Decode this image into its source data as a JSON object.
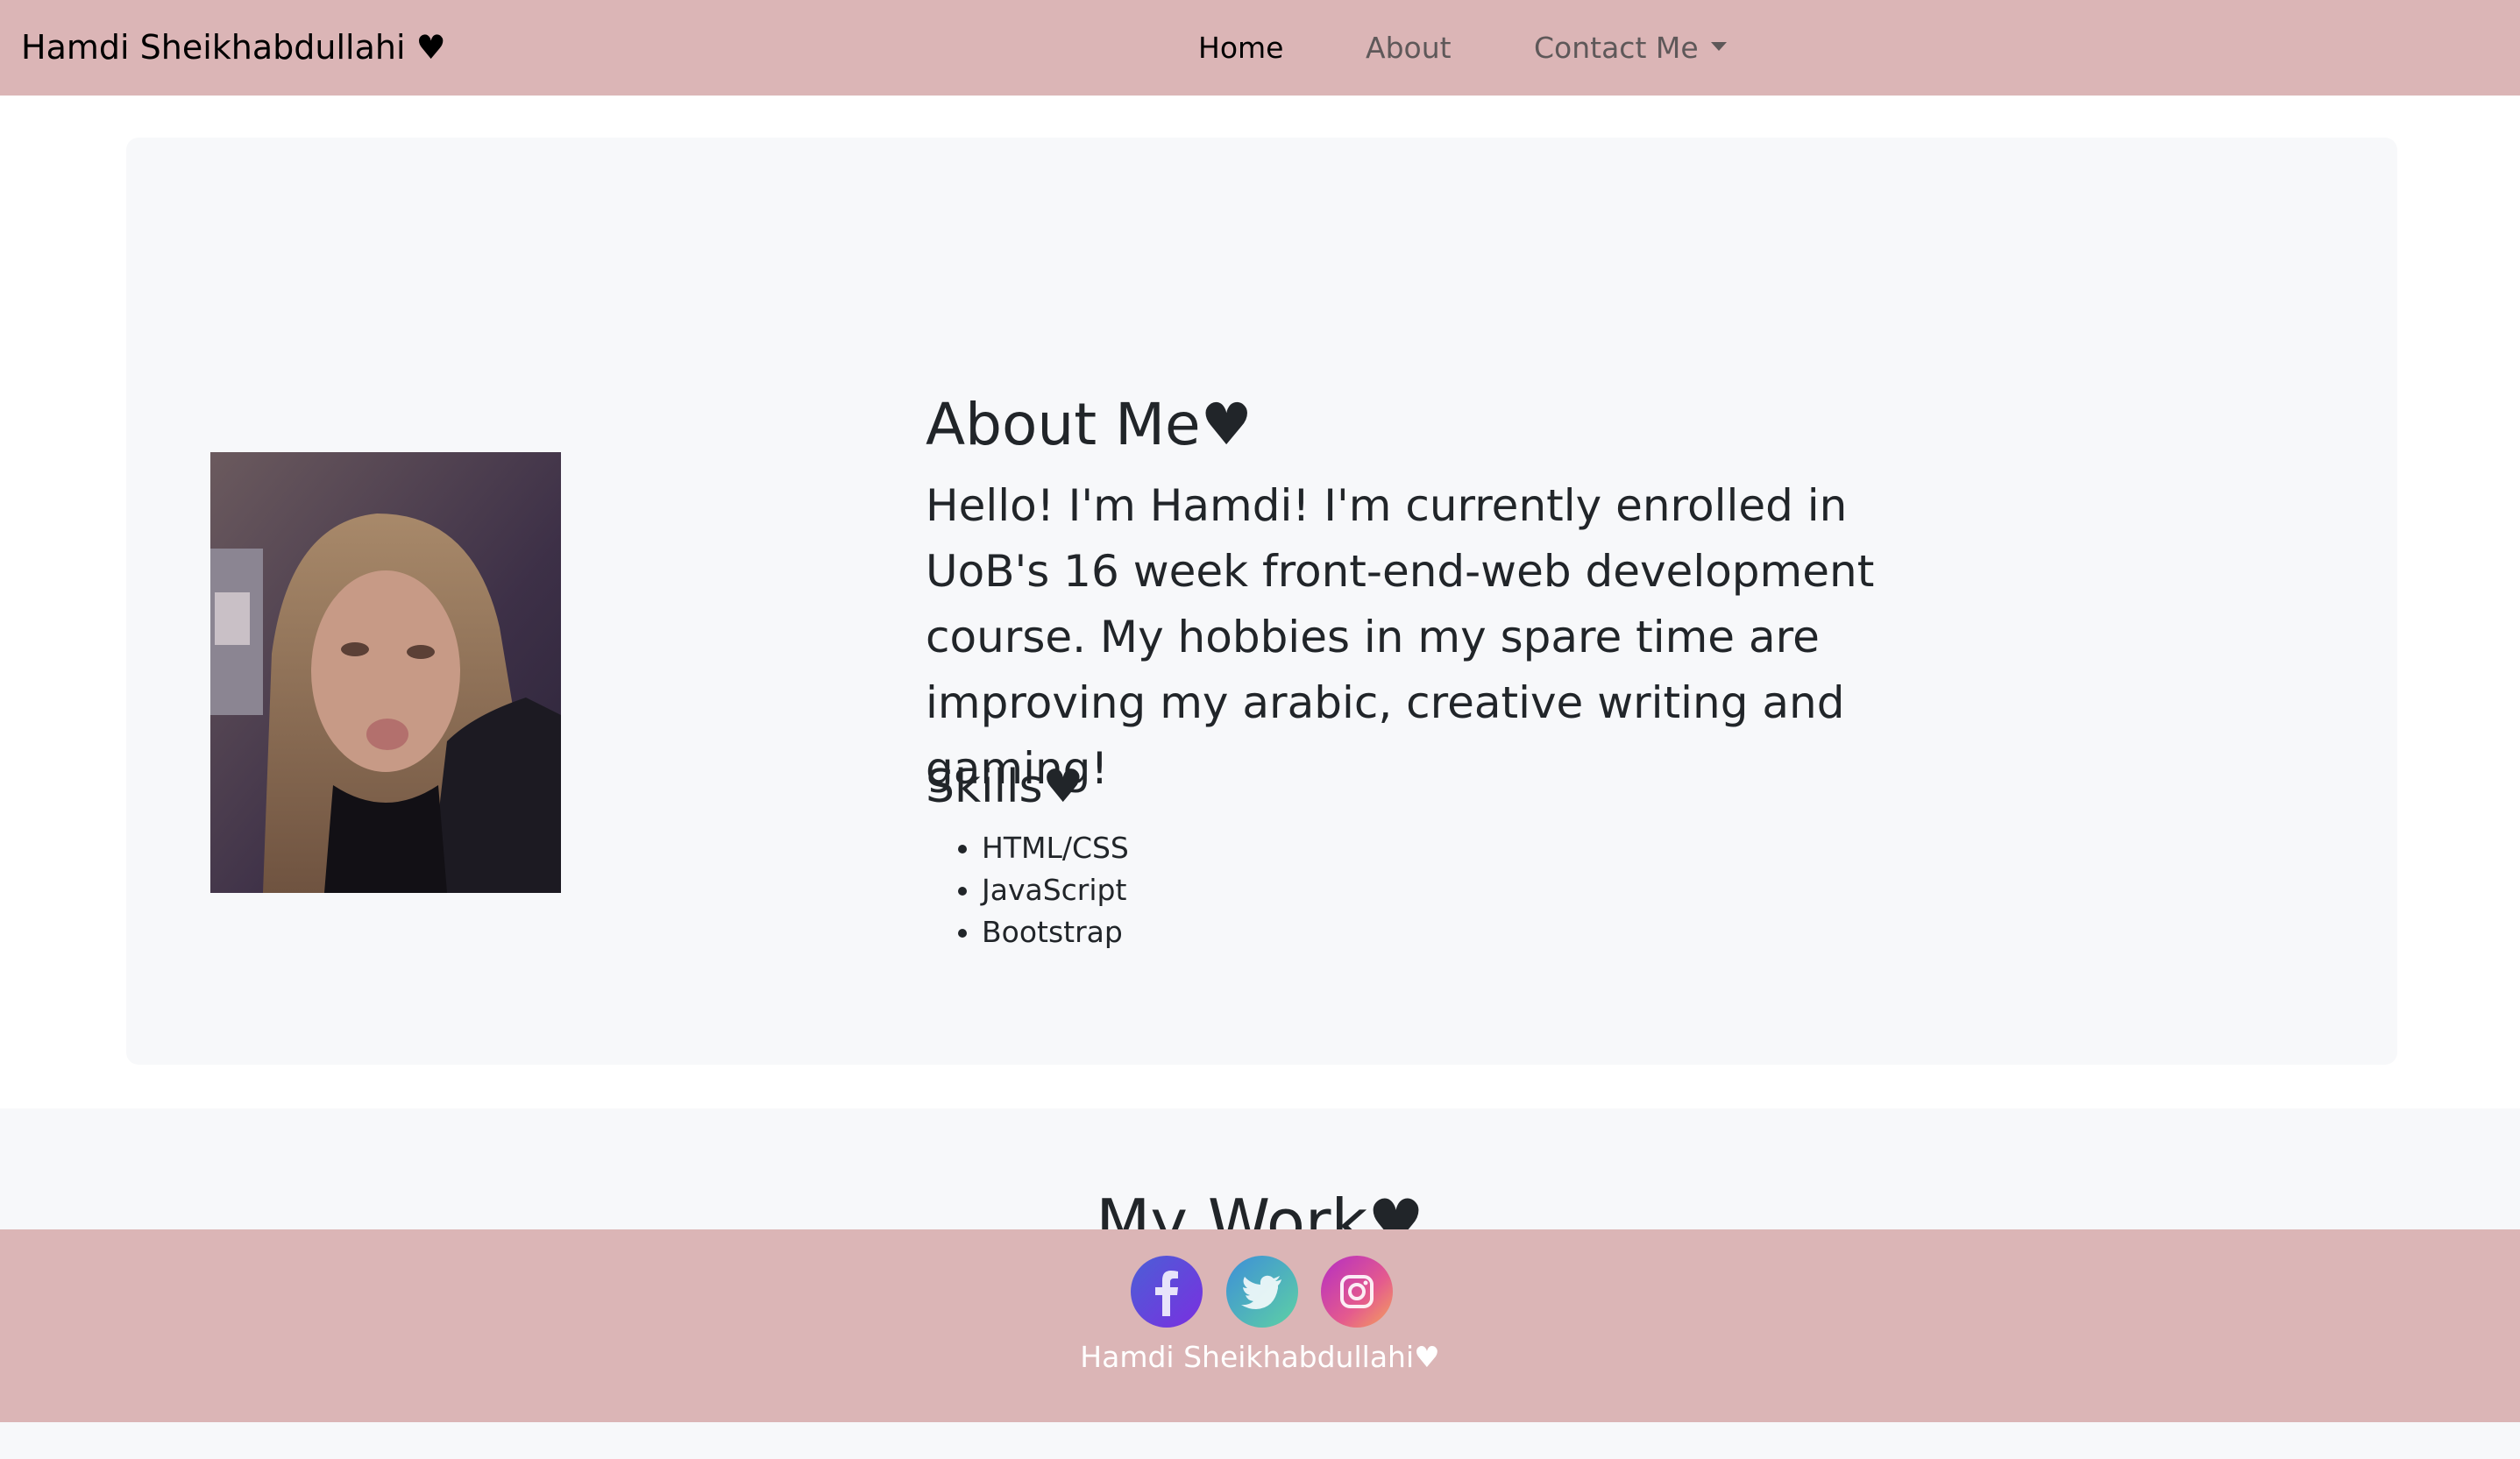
{
  "navbar": {
    "brand": "Hamdi Sheikhabdullahi ♥",
    "links": [
      {
        "label": "Home"
      },
      {
        "label": "About"
      },
      {
        "label": "Contact Me"
      }
    ]
  },
  "about": {
    "title": "About Me♥",
    "text": "Hello! I'm Hamdi! I'm currently enrolled in UoB's 16 week front-end-web development course. My hobbies in my spare time are improving my arabic, creative writing and gaming!",
    "skills_title": "Skills♥",
    "skills": [
      "HTML/CSS",
      "JavaScript",
      "Bootstrap"
    ]
  },
  "work": {
    "title": "My Work♥"
  },
  "footer": {
    "social": [
      {
        "icon": "facebook-icon"
      },
      {
        "icon": "twitter-icon"
      },
      {
        "icon": "instagram-icon"
      }
    ],
    "name": "Hamdi Sheikhabdullahi♥"
  },
  "colors": {
    "navbar_bg": "#dbb5b6",
    "panel_bg": "#f7f8fa",
    "text": "#212529"
  }
}
